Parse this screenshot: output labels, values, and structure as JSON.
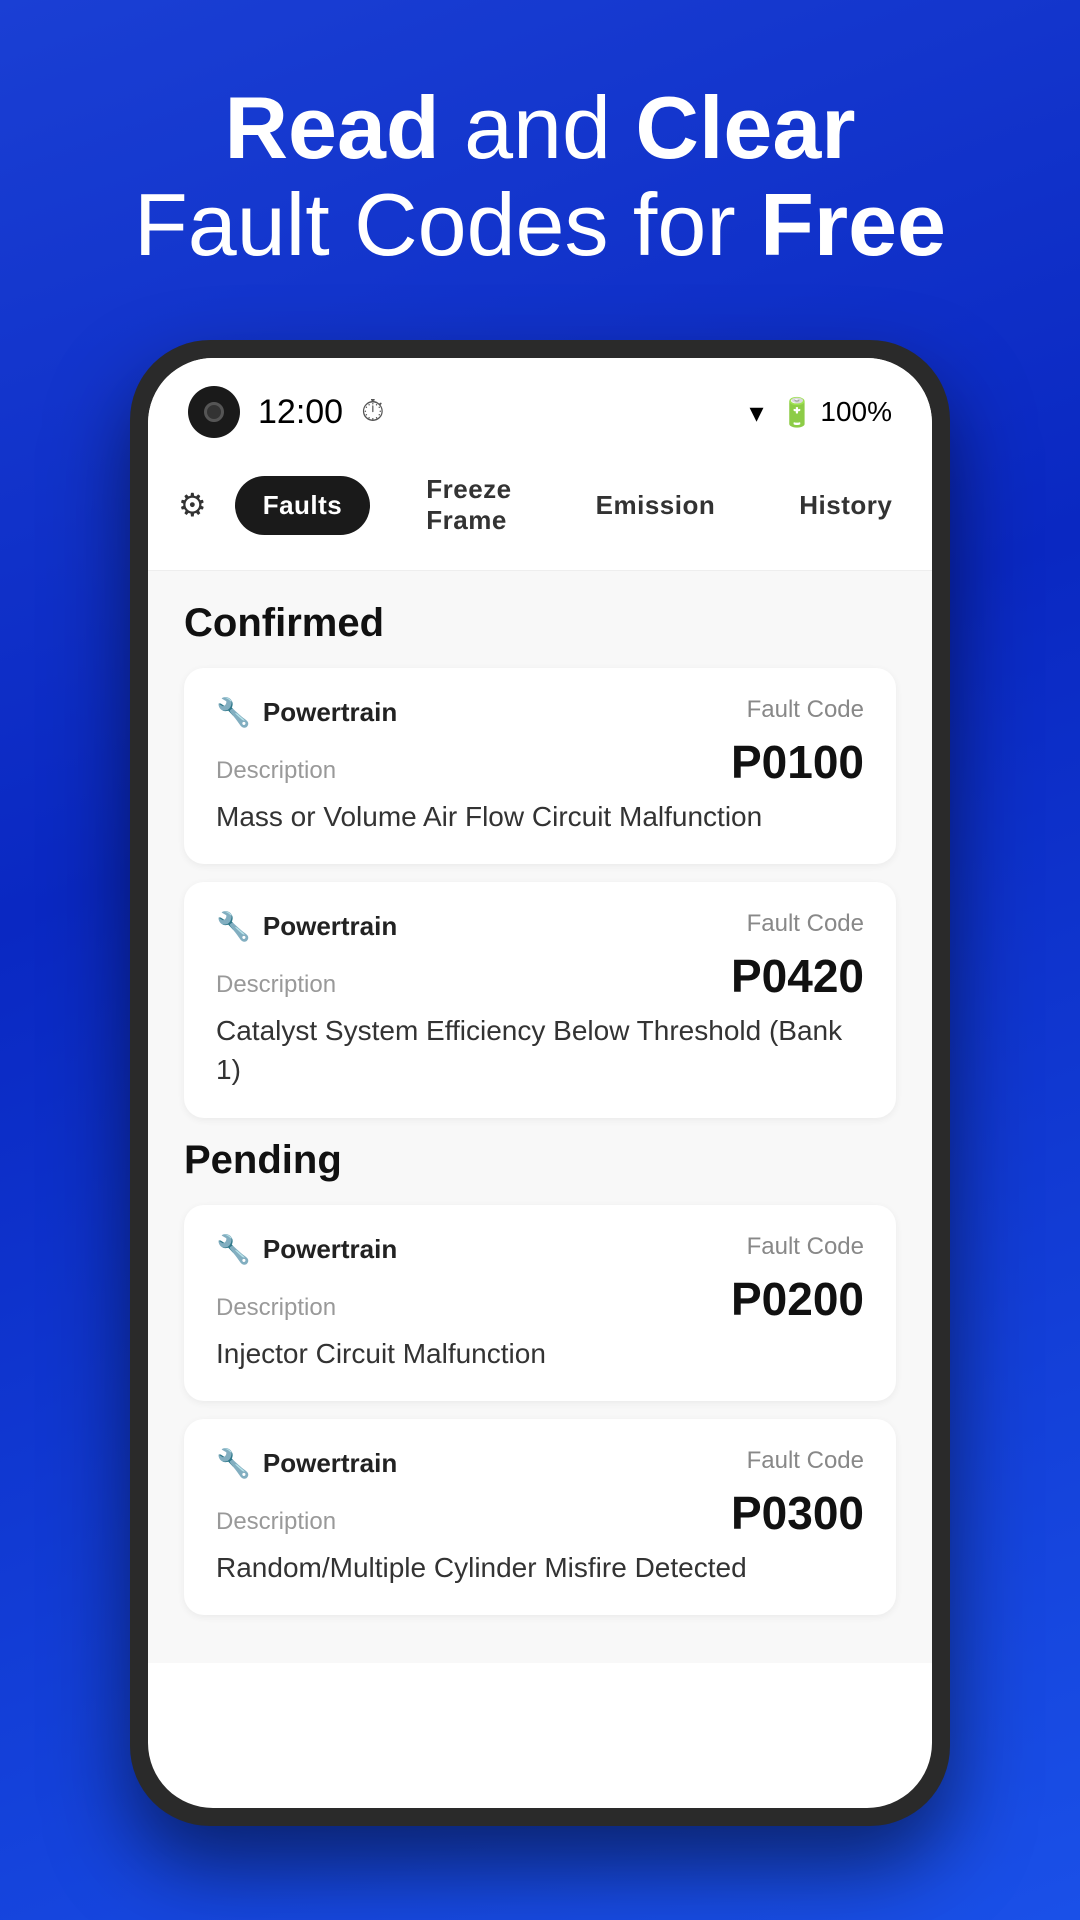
{
  "hero": {
    "line1_normal": "and",
    "line1_bold1": "Read",
    "line1_bold2": "Clear",
    "line2_normal": "Fault Codes for",
    "line2_bold": "Free"
  },
  "status_bar": {
    "time": "12:00",
    "battery": "100%"
  },
  "nav": {
    "tabs": [
      {
        "label": "Faults",
        "active": true
      },
      {
        "label": "Freeze Frame",
        "active": false
      },
      {
        "label": "Emission",
        "active": false
      },
      {
        "label": "History",
        "active": false
      }
    ]
  },
  "sections": [
    {
      "title": "Confirmed",
      "faults": [
        {
          "type": "Powertrain",
          "fault_code_label": "Fault Code",
          "fault_code": "P0100",
          "desc_label": "Description",
          "description": "Mass or Volume Air Flow Circuit Malfunction"
        },
        {
          "type": "Powertrain",
          "fault_code_label": "Fault Code",
          "fault_code": "P0420",
          "desc_label": "Description",
          "description": "Catalyst System Efficiency Below Threshold (Bank 1)"
        }
      ]
    },
    {
      "title": "Pending",
      "faults": [
        {
          "type": "Powertrain",
          "fault_code_label": "Fault Code",
          "fault_code": "P0200",
          "desc_label": "Description",
          "description": "Injector Circuit Malfunction"
        },
        {
          "type": "Powertrain",
          "fault_code_label": "Fault Code",
          "fault_code": "P0300",
          "desc_label": "Description",
          "description": "Random/Multiple Cylinder Misfire Detected"
        }
      ]
    }
  ]
}
